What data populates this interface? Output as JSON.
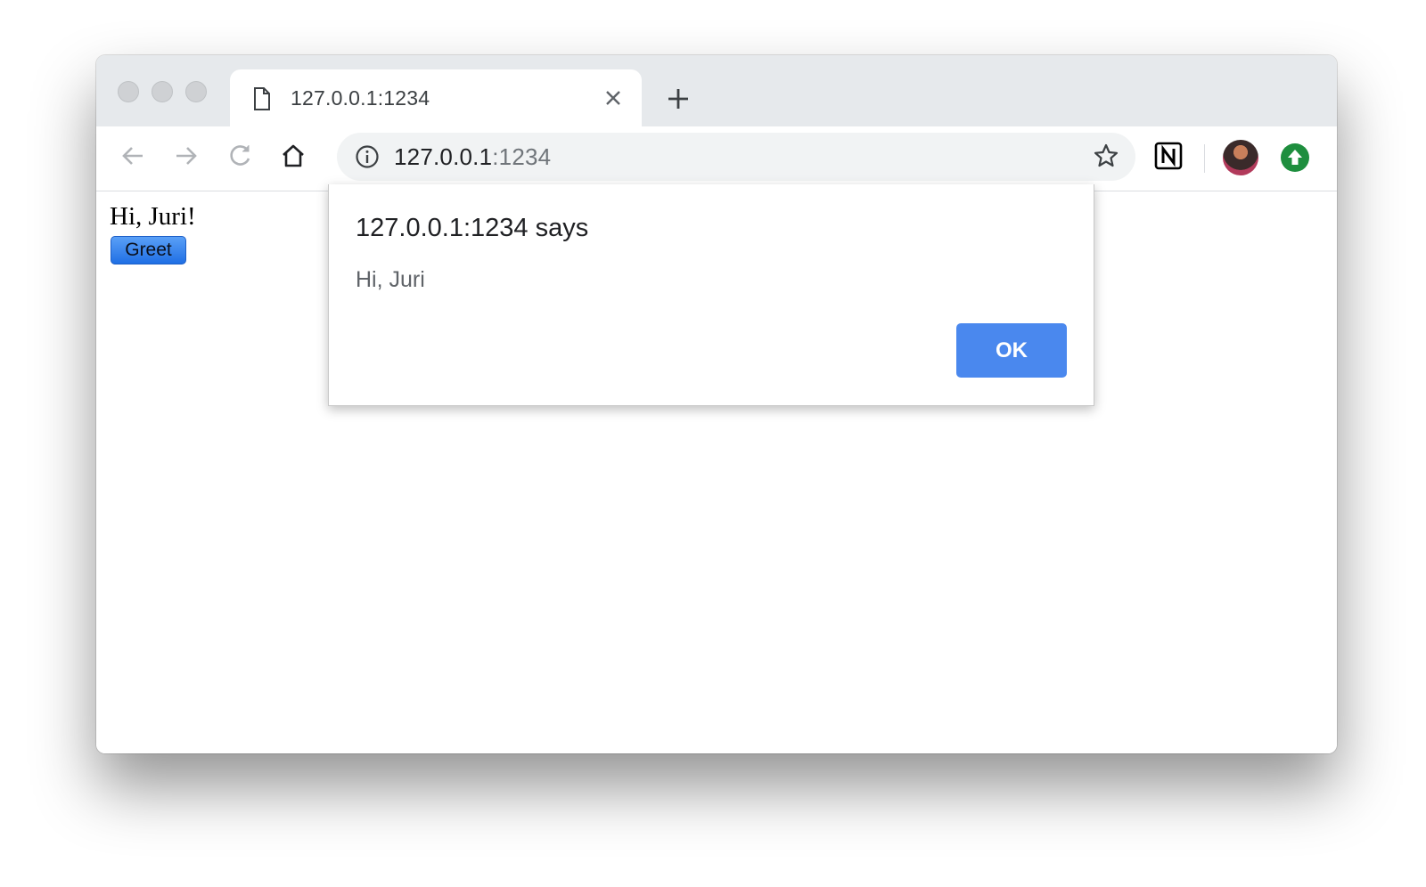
{
  "tab": {
    "title": "127.0.0.1:1234"
  },
  "toolbar": {
    "url_host": "127.0.0.1",
    "url_port": ":1234"
  },
  "page": {
    "text": "Hi, Juri!",
    "button_label": "Greet"
  },
  "dialog": {
    "title": "127.0.0.1:1234 says",
    "message": "Hi, Juri",
    "ok_label": "OK"
  },
  "colors": {
    "ok_button": "#4a88ee",
    "greet_button": "#2f7ff0",
    "update_badge": "#1e8e3e"
  },
  "icons": [
    "page-icon",
    "close-icon",
    "plus-icon",
    "back-arrow-icon",
    "forward-arrow-icon",
    "reload-icon",
    "home-icon",
    "info-icon",
    "star-icon",
    "notion-icon",
    "avatar",
    "update-icon"
  ]
}
